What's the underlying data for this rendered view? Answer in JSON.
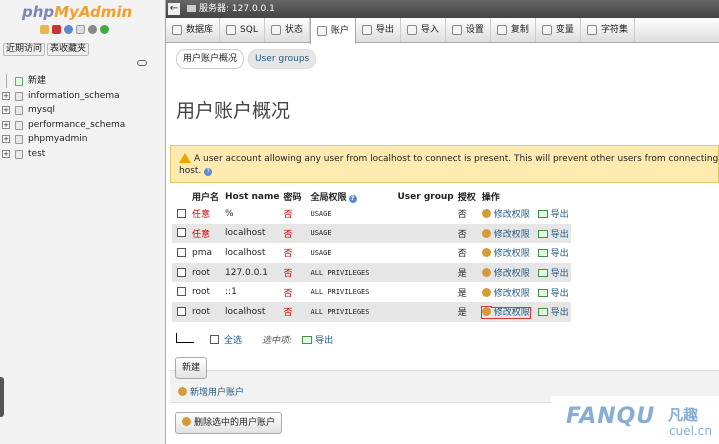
{
  "nav": {
    "logo_php": "php",
    "logo_myadmin": "MyAdmin",
    "recent_tab": "近期访问",
    "favorites_tab": "表收藏夹",
    "tree": [
      {
        "label": "新建",
        "type": "new"
      },
      {
        "label": "information_schema",
        "type": "db"
      },
      {
        "label": "mysql",
        "type": "db"
      },
      {
        "label": "performance_schema",
        "type": "db"
      },
      {
        "label": "phpmyadmin",
        "type": "db"
      },
      {
        "label": "test",
        "type": "db"
      }
    ]
  },
  "serverbar": {
    "prefix": "服务器:",
    "host": "127.0.0.1"
  },
  "tabs": [
    {
      "label": "数据库",
      "icon": "database-icon"
    },
    {
      "label": "SQL",
      "icon": "sql-icon"
    },
    {
      "label": "状态",
      "icon": "status-icon"
    },
    {
      "label": "账户",
      "icon": "accounts-icon",
      "active": true
    },
    {
      "label": "导出",
      "icon": "export-icon"
    },
    {
      "label": "导入",
      "icon": "import-icon"
    },
    {
      "label": "设置",
      "icon": "wrench-icon"
    },
    {
      "label": "复制",
      "icon": "replication-icon"
    },
    {
      "label": "变量",
      "icon": "variables-icon"
    },
    {
      "label": "字符集",
      "icon": "charset-icon"
    }
  ],
  "subtabs": {
    "overview": "用户账户概况",
    "groups": "User groups"
  },
  "page_title": "用户账户概况",
  "notice": {
    "text": "A user account allowing any user from localhost to connect is present. This will prevent other users from connecting if the host p",
    "text2": "host."
  },
  "table": {
    "headers": {
      "user": "用户名",
      "host": "Host name",
      "password": "密码",
      "global": "全局权限",
      "group": "User group",
      "grant": "授权",
      "action": "操作"
    },
    "rows": [
      {
        "user": "任意",
        "host": "%",
        "password": "否",
        "global": "USAGE",
        "grant": "否",
        "edit": "修改权限",
        "export": "导出",
        "any": true
      },
      {
        "user": "任意",
        "host": "localhost",
        "password": "否",
        "global": "USAGE",
        "grant": "否",
        "edit": "修改权限",
        "export": "导出",
        "any": true
      },
      {
        "user": "pma",
        "host": "localhost",
        "password": "否",
        "global": "USAGE",
        "grant": "否",
        "edit": "修改权限",
        "export": "导出"
      },
      {
        "user": "root",
        "host": "127.0.0.1",
        "password": "否",
        "global": "ALL PRIVILEGES",
        "grant": "是",
        "edit": "修改权限",
        "export": "导出"
      },
      {
        "user": "root",
        "host": "::1",
        "password": "否",
        "global": "ALL PRIVILEGES",
        "grant": "是",
        "edit": "修改权限",
        "export": "导出"
      },
      {
        "user": "root",
        "host": "localhost",
        "password": "否",
        "global": "ALL PRIVILEGES",
        "grant": "是",
        "edit": "修改权限",
        "export": "导出",
        "highlight": true
      }
    ]
  },
  "with_selected": {
    "check_all": "全选",
    "label": "选中项:",
    "export": "导出"
  },
  "buttons": {
    "go": "新建",
    "add_user": "新增用户账户",
    "delete": "删除选中的用户账户"
  },
  "watermark": {
    "latin": "FANQU",
    "chinese": "凡趣",
    "domain": "cuel.cn"
  }
}
